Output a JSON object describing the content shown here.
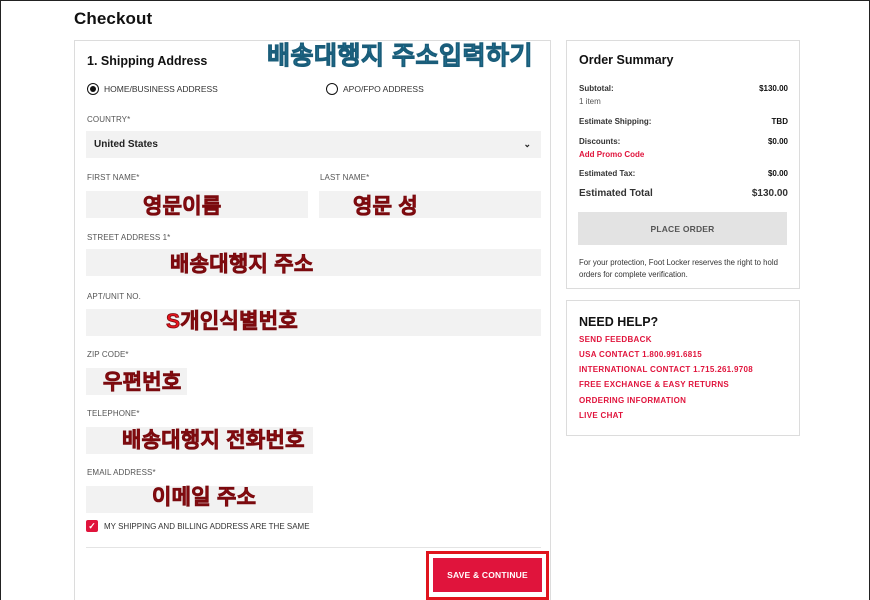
{
  "page": {
    "title": "Checkout"
  },
  "shipping": {
    "section_title": "1. Shipping Address",
    "overlay_title": "배송대행지 주소입력하기",
    "address_types": [
      "HOME/BUSINESS ADDRESS",
      "APO/FPO ADDRESS"
    ],
    "selected_address_type": "HOME/BUSINESS ADDRESS",
    "country_label": "COUNTRY*",
    "country_value": "United States",
    "first_name_label": "FIRST NAME*",
    "first_name_note": "영문이름",
    "last_name_label": "LAST NAME*",
    "last_name_note": "영문 성",
    "street_label": "STREET ADDRESS 1*",
    "street_note": "배송대행지 주소",
    "apt_label": "APT/UNIT NO.",
    "apt_note": "S개인식별번호",
    "zip_label": "ZIP CODE*",
    "zip_note": "우편번호",
    "phone_label": "TELEPHONE*",
    "phone_note": "배송대행지 전화번호",
    "email_label": "EMAIL ADDRESS*",
    "email_note": "이메일 주소",
    "same_billing_label": "MY SHIPPING AND BILLING ADDRESS ARE THE SAME",
    "same_billing_checked": true,
    "save_button": "SAVE & CONTINUE"
  },
  "summary": {
    "title": "Order Summary",
    "subtotal_label": "Subtotal:",
    "subtotal_value": "$130.00",
    "items": "1 item",
    "shipping_label": "Estimate Shipping:",
    "shipping_value": "TBD",
    "discounts_label": "Discounts:",
    "discounts_value": "$0.00",
    "promo_link": "Add Promo Code",
    "tax_label": "Estimated Tax:",
    "tax_value": "$0.00",
    "total_label": "Estimated Total",
    "total_value": "$130.00",
    "place_order": "PLACE ORDER",
    "notice": "For your protection, Foot Locker reserves the right to hold orders for complete verification."
  },
  "help": {
    "title": "NEED HELP?",
    "links": [
      "SEND FEEDBACK",
      "USA CONTACT 1.800.991.6815",
      "INTERNATIONAL CONTACT 1.715.261.9708",
      "FREE EXCHANGE & EASY RETURNS",
      "ORDERING INFORMATION",
      "LIVE CHAT"
    ]
  },
  "colors": {
    "accent": "#e0143c",
    "field_bg": "#f2f2f2",
    "overlay_blue": "#35b6e6",
    "overlay_red": "#e8141d"
  }
}
